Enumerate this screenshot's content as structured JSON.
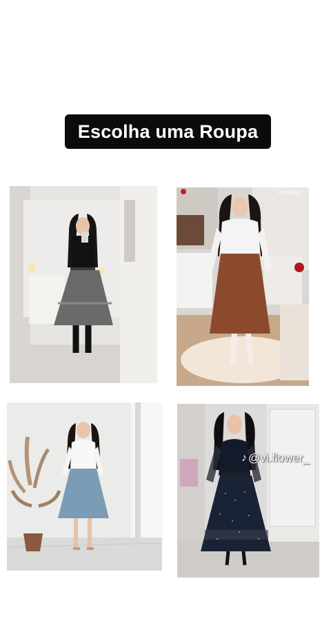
{
  "header": {
    "title": "Escolha uma Roupa"
  },
  "watermark": {
    "icon": "tiktok-icon",
    "glyph": "♪",
    "handle": "@vi.flower_"
  },
  "photos": [
    {
      "name": "outfit-photo-1",
      "desc": "black top with gray tiered skirt"
    },
    {
      "name": "outfit-photo-2",
      "desc": "white blouse with brown leather skirt",
      "signature": "sunday"
    },
    {
      "name": "outfit-photo-3",
      "desc": "white top with light blue skirt"
    },
    {
      "name": "outfit-photo-4",
      "desc": "navy polka dot dress with sheer sleeves"
    }
  ],
  "colors": {
    "title_bg": "#0b0b0b",
    "title_fg": "#ffffff",
    "page_bg": "#ffffff"
  }
}
